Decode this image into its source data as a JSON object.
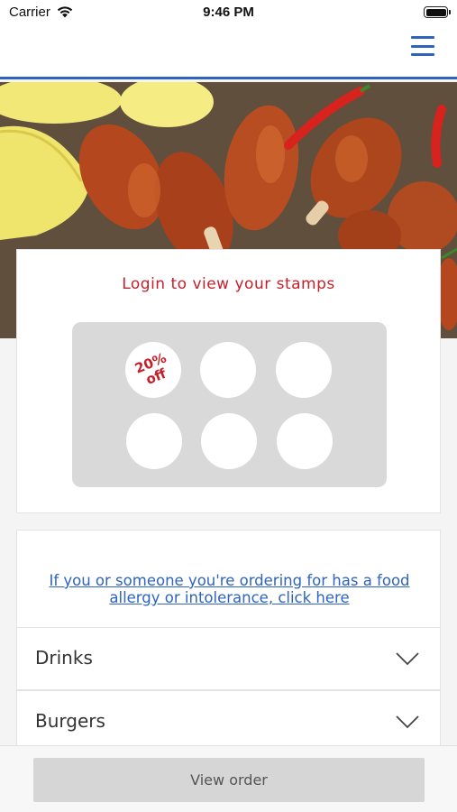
{
  "status_bar": {
    "carrier": "Carrier",
    "time": "9:46 PM"
  },
  "header": {
    "menu_icon": "hamburger-icon",
    "accent_color": "#2e64bd"
  },
  "hero": {
    "image": "grilled chicken drumsticks with lemon wedges and chili peppers"
  },
  "stamp_card": {
    "title": "Login to view your stamps",
    "reward_line1": "20%",
    "reward_line2": "off",
    "stamp_count": 6,
    "title_color": "#c5202a"
  },
  "allergy": {
    "link_text": "If you or someone you're ordering for has a food allergy or intolerance, click here"
  },
  "categories": [
    {
      "label": "Drinks"
    },
    {
      "label": "Burgers"
    }
  ],
  "footer": {
    "view_order_label": "View order"
  }
}
